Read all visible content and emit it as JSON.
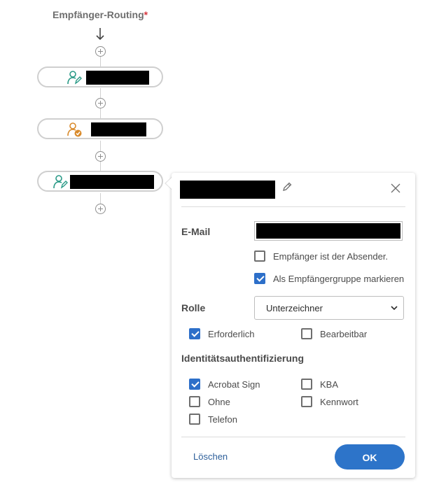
{
  "routing": {
    "title": "Empfänger-Routing",
    "required_mark": "*",
    "recipients": [
      {
        "role_icon": "signer-icon",
        "icon_color": "#2a9a87"
      },
      {
        "role_icon": "approver-icon",
        "icon_color": "#d98a2b"
      },
      {
        "role_icon": "signer-icon",
        "icon_color": "#2a9a87"
      }
    ]
  },
  "panel": {
    "email_label": "E-Mail",
    "sender_checkbox": {
      "label": "Empfänger ist der Absender.",
      "checked": false
    },
    "group_checkbox": {
      "label": "Als Empfängergruppe markieren",
      "checked": true
    },
    "role_label": "Rolle",
    "role_value": "Unterzeichner",
    "required_checkbox": {
      "label": "Erforderlich",
      "checked": true
    },
    "editable_checkbox": {
      "label": "Bearbeitbar",
      "checked": false
    },
    "auth_label": "Identitätsauthentifizierung",
    "auth_options": {
      "acrobat_sign": {
        "label": "Acrobat Sign",
        "checked": true
      },
      "kba": {
        "label": "KBA",
        "checked": false
      },
      "none": {
        "label": "Ohne",
        "checked": false
      },
      "password": {
        "label": "Kennwort",
        "checked": false
      },
      "phone": {
        "label": "Telefon",
        "checked": false
      }
    },
    "delete_label": "Löschen",
    "ok_label": "OK"
  },
  "colors": {
    "accent": "#2d74c9",
    "required": "#d7373f",
    "link": "#2d5f9a"
  }
}
